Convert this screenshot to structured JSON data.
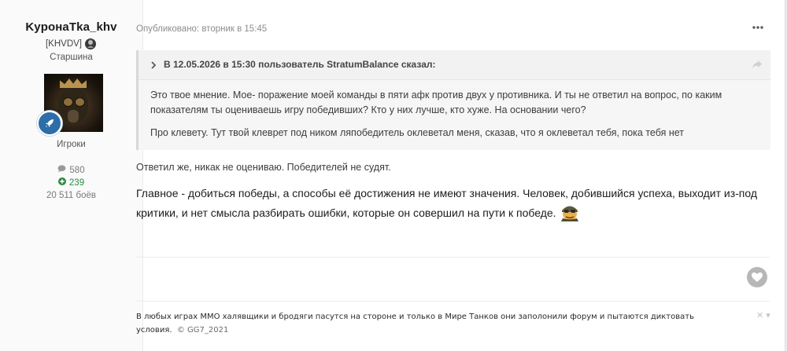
{
  "author": {
    "name": "KypoнaTka_khv",
    "clan_tag": "[KHVDV]",
    "rank": "Старшина",
    "group": "Игроки",
    "posts_count": "580",
    "reputation": "239",
    "battles": "20 511 боёв"
  },
  "post": {
    "published": "Опубликовано: вторник в 15:45",
    "quote": {
      "citation": "В 12.05.2026 в 15:30 пользователь StratumBalance сказал:",
      "paragraphs": [
        "Это твое мнение. Мое- поражение моей команды в пяти афк против двух у противника. И ты не ответил на вопрос, по каким показателям ты оцениваешь игру победивших? Кто у них лучше, кто хуже. На основании чего?",
        "Про клевету. Тут твой клеврет под ником ляпобедитель оклеветал меня, сказав, что я оклеветал тебя, пока тебя нет"
      ]
    },
    "reply_line_1": "Ответил же, никак не оцениваю. Победителей не судят.",
    "reply_line_2": "Главное - добиться победы, а способы её достижения не имеют значения. Человек, добившийся успеха, выходит из-под критики, и нет смысла разбирать ошибки, которые он совершил на пути к победе."
  },
  "signature": {
    "text": "В любых играх ММО халявщики и бродяги пасутся на стороне и только в Мире Танков они заполонили форум и пытаются диктовать условия.",
    "author": "© GG7_2021",
    "close_label": "✕ ▾"
  },
  "icons": {
    "badge": "rocket-icon",
    "posts": "speech-bubble-icon",
    "reputation": "plus-circle-icon",
    "more": "ellipsis-icon",
    "share": "share-icon",
    "like": "heart-icon"
  },
  "colors": {
    "badge_blue": "#2d6ea8",
    "reputation_green": "#2b8a3e",
    "like_grey": "#b7b7b7"
  }
}
